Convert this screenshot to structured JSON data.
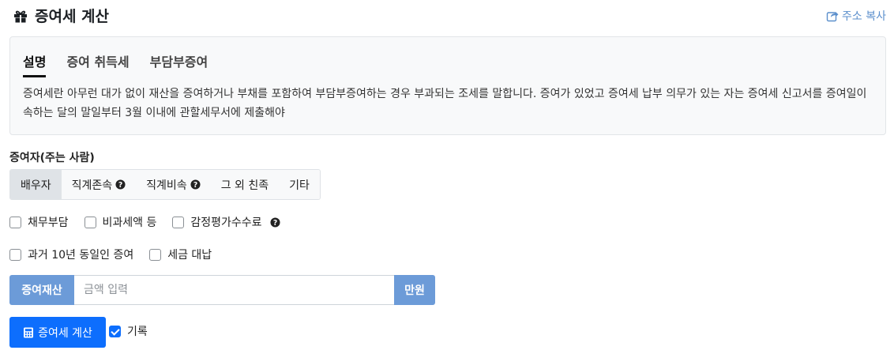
{
  "header": {
    "title": "증여세 계산",
    "title_icon": "gift-icon",
    "share_label": "주소 복사",
    "share_icon": "share-icon",
    "link_color": "#5b8fcc"
  },
  "info": {
    "tabs": [
      {
        "label": "설명",
        "active": true
      },
      {
        "label": "증여 취득세",
        "active": false
      },
      {
        "label": "부담부증여",
        "active": false
      }
    ],
    "description": "증여세란 아무런 대가 없이 재산을 증여하거나 부채를 포함하여 부담부증여하는 경우 부과되는 조세를 말합니다. 증여가 있었고 증여세 납부 의무가 있는 자는 증여세 신고서를 증여일이 속하는 달의 말일부터 3월 이내에 관할세무서에 제출해야"
  },
  "donor": {
    "label": "증여자(주는 사람)",
    "options": [
      {
        "label": "배우자",
        "active": true,
        "help": false
      },
      {
        "label": "직계존속",
        "active": false,
        "help": true
      },
      {
        "label": "직계비속",
        "active": false,
        "help": true
      },
      {
        "label": "그 외 친족",
        "active": false,
        "help": false
      },
      {
        "label": "기타",
        "active": false,
        "help": false
      }
    ]
  },
  "options_row1": [
    {
      "label": "채무부담",
      "checked": false
    },
    {
      "label": "비과세액 등",
      "checked": false
    },
    {
      "label": "감정평가수수료",
      "checked": false,
      "help": true
    }
  ],
  "options_row2": [
    {
      "label": "과거 10년 동일인 증여",
      "checked": false
    },
    {
      "label": "세금 대납",
      "checked": false
    }
  ],
  "asset": {
    "prefix": "증여재산",
    "placeholder": "금액 입력",
    "value": "",
    "suffix": "만원",
    "accent": "#6c9bd8"
  },
  "actions": {
    "calc_label": "증여세 계산",
    "calc_icon": "calculator-icon",
    "record_label": "기록",
    "record_checked": true,
    "primary_color": "#0d6efd"
  }
}
